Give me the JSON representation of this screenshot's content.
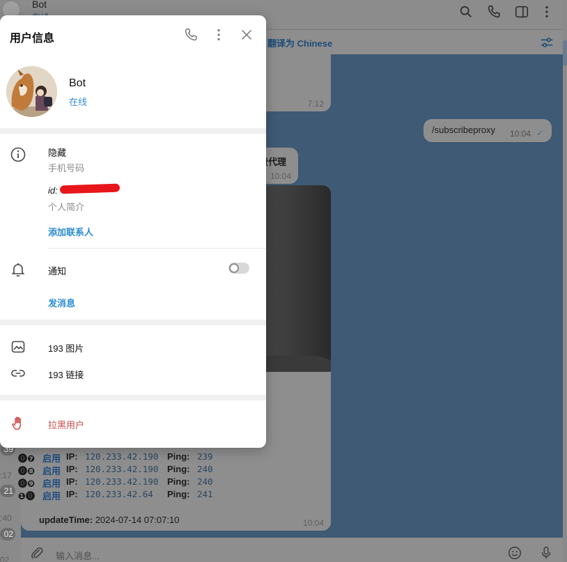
{
  "chat_header": {
    "title": "Bot",
    "status": "在线"
  },
  "translate_bar": {
    "label": "翻译为 Chinese"
  },
  "sidebar": {
    "badges": [
      "39",
      "21",
      "02"
    ],
    "times": [
      ":17",
      ":40",
      "02"
    ]
  },
  "messages": {
    "first_time": "7:12",
    "sent_command": "/subscribeproxy",
    "sent_time": "10:04",
    "reply_fragment": "费代理",
    "reply_time": "10:04",
    "proxy_rows": [
      {
        "num": "⓿❼",
        "state": "启用",
        "ip_label": "IP:",
        "ip": "120.233.42.190",
        "ping_label": "Ping:",
        "ping": "239"
      },
      {
        "num": "⓿❽",
        "state": "启用",
        "ip_label": "IP:",
        "ip": "120.233.42.190",
        "ping_label": "Ping:",
        "ping": "240"
      },
      {
        "num": "⓿❾",
        "state": "启用",
        "ip_label": "IP:",
        "ip": "120.233.42.190",
        "ping_label": "Ping:",
        "ping": "240"
      },
      {
        "num": "❶⓿",
        "state": "启用",
        "ip_label": "IP:",
        "ip": " 120.233.42.64",
        "ping_label": "Ping:",
        "ping": "241"
      }
    ],
    "update_label": "updateTime:",
    "update_value": "2024-07-14 07:07:10",
    "update_msg_time": "10:04"
  },
  "composer": {
    "placeholder": "输入消息..."
  },
  "modal": {
    "title": "用户信息",
    "user_name": "Bot",
    "user_status": "在线",
    "phone_value": "隐藏",
    "phone_label": "手机号码",
    "id_prefix": "id:",
    "bio_label": "个人简介",
    "add_contact": "添加联系人",
    "notifications_label": "通知",
    "notifications_on": false,
    "send_message": "发消息",
    "photos": "193 图片",
    "links": "193 链接",
    "block_user": "拉黑用户"
  },
  "colors": {
    "accent": "#2a8cd3",
    "danger": "#d04a47",
    "chat_bg_dimmed": "#3e5a74"
  }
}
